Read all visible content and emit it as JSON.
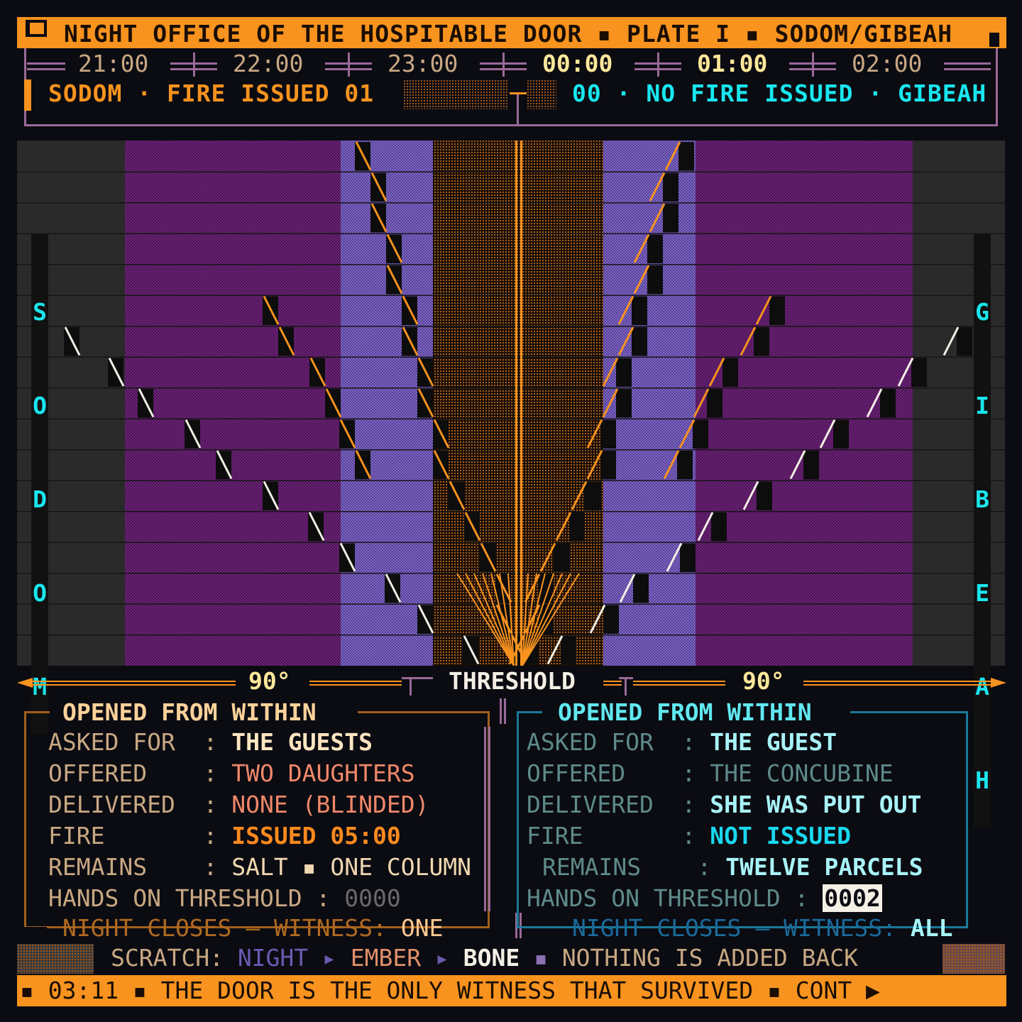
{
  "header": {
    "title": "NIGHT OFFICE OF THE HOSPITABLE DOOR ▪ PLATE I ▪ SODOM/GIBEAH"
  },
  "timeline": {
    "hours": [
      "21:00",
      "22:00",
      "23:00",
      "00:00",
      "01:00",
      "02:00"
    ],
    "sodom_status": "SODOM · FIRE ISSUED 01",
    "gibeah_status": "00 · NO FIRE ISSUED · GIBEAH"
  },
  "field": {
    "left_label": [
      "S",
      "O",
      "D",
      "O",
      "M"
    ],
    "right_label": [
      "G",
      "I",
      "B",
      "E",
      "A",
      "H"
    ]
  },
  "threshold": {
    "label": "THRESHOLD",
    "left_angle": "90°",
    "right_angle": "90°"
  },
  "left_panel": {
    "title": "OPENED FROM WITHIN",
    "rows": [
      {
        "key": "ASKED FOR  ",
        "sep": ":",
        "value": "THE GUESTS"
      },
      {
        "key": "OFFERED    ",
        "sep": ":",
        "value": "TWO DAUGHTERS"
      },
      {
        "key": "DELIVERED  ",
        "sep": ":",
        "value": "NONE (BLINDED)"
      },
      {
        "key": "FIRE       ",
        "sep": ":",
        "value": "ISSUED 05:00"
      },
      {
        "key": "REMAINS    ",
        "sep": ":",
        "value": "SALT ▪ ONE COLUMN"
      },
      {
        "key": "HANDS ON THRESHOLD ",
        "sep": ":",
        "value": "0000"
      }
    ],
    "closing_prefix": "NIGHT CLOSES — WITNESS: ",
    "closing_value": "ONE"
  },
  "right_panel": {
    "title": "OPENED FROM WITHIN",
    "rows": [
      {
        "key": "ASKED FOR  ",
        "sep": ":",
        "value": "THE GUEST"
      },
      {
        "key": "OFFERED    ",
        "sep": ":",
        "value": "THE CONCUBINE"
      },
      {
        "key": "DELIVERED  ",
        "sep": ":",
        "value": "SHE WAS PUT OUT"
      },
      {
        "key": "FIRE       ",
        "sep": ":",
        "value": "NOT ISSUED"
      },
      {
        "key": "REMAINS    ",
        "sep": ":",
        "value": "TWELVE PARCELS"
      },
      {
        "key": "HANDS ON THRESHOLD ",
        "sep": ":",
        "value": "0002"
      }
    ],
    "closing_prefix": "NIGHT CLOSES — WITNESS: ",
    "closing_value": "ALL"
  },
  "scratch": {
    "prefix": "SCRATCH: ",
    "night": "NIGHT",
    "arrow1": " ▸ ",
    "ember": "EMBER",
    "arrow2": " ▸ ",
    "bone": "BONE",
    "sep": " ▪ ",
    "tail": "NOTHING IS ADDED BACK"
  },
  "footer": {
    "text": "▪ 03:11 ▪ THE DOOR IS THE ONLY WITNESS THAT SURVIVED ▪ CONT ▶"
  },
  "colors": {
    "ember": "#f7931e",
    "cyan": "#19e6ee",
    "violet": "#6a4aa0",
    "magenta": "#5a1a60",
    "bone": "#f4f0e6"
  }
}
